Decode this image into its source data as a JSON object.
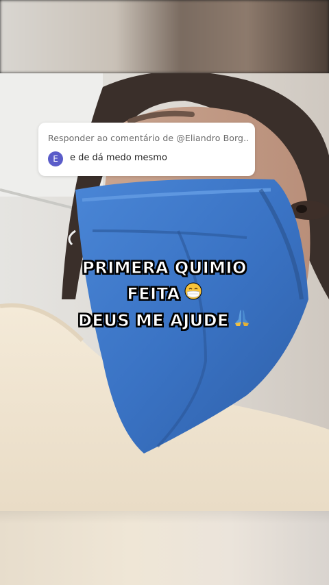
{
  "reply": {
    "header": "Responder ao comentário de @Eliandro Borg...",
    "avatar_initial": "E",
    "comment": "e de dá medo mesmo"
  },
  "caption": {
    "line1": "PRIMERA QUIMIO",
    "line2": "FEITA",
    "line3": "DEUS ME AJUDE"
  },
  "icons": {
    "line2_emoji": "face-with-medical-mask-icon",
    "line3_emoji": "folded-hands-icon"
  },
  "colors": {
    "avatar": "#5a5cc9",
    "mask_blue": "#3a73c4",
    "caption_text": "#ffffff",
    "caption_outline": "#000000"
  }
}
